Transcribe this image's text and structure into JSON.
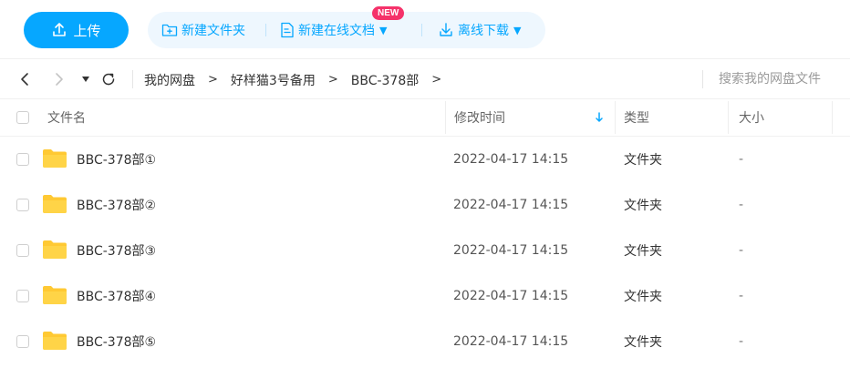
{
  "toolbar": {
    "upload_label": "上传",
    "new_folder_label": "新建文件夹",
    "new_online_doc_label": "新建在线文档",
    "new_badge": "NEW",
    "offline_download_label": "离线下载",
    "accent_color": "#06a7ff",
    "badge_color": "#f5326a"
  },
  "nav": {
    "back_icon": "chevron-left-icon",
    "forward_icon": "chevron-right-icon",
    "dropdown_icon": "caret-down-icon",
    "refresh_icon": "refresh-icon",
    "breadcrumbs": [
      {
        "label": "我的网盘"
      },
      {
        "label": "好样猫3号备用"
      },
      {
        "label": "BBC-378部"
      }
    ],
    "search_placeholder": "搜索我的网盘文件"
  },
  "table": {
    "columns": {
      "name": "文件名",
      "modified": "修改时间",
      "type": "类型",
      "size": "大小"
    },
    "sort_icon": "sort-down-arrow-icon",
    "rows": [
      {
        "name": "BBC-378部①",
        "modified": "2022-04-17 14:15",
        "type": "文件夹",
        "size": "-"
      },
      {
        "name": "BBC-378部②",
        "modified": "2022-04-17 14:15",
        "type": "文件夹",
        "size": "-"
      },
      {
        "name": "BBC-378部③",
        "modified": "2022-04-17 14:15",
        "type": "文件夹",
        "size": "-"
      },
      {
        "name": "BBC-378部④",
        "modified": "2022-04-17 14:15",
        "type": "文件夹",
        "size": "-"
      },
      {
        "name": "BBC-378部⑤",
        "modified": "2022-04-17 14:15",
        "type": "文件夹",
        "size": "-"
      }
    ],
    "folder_color": "#ffc933"
  }
}
